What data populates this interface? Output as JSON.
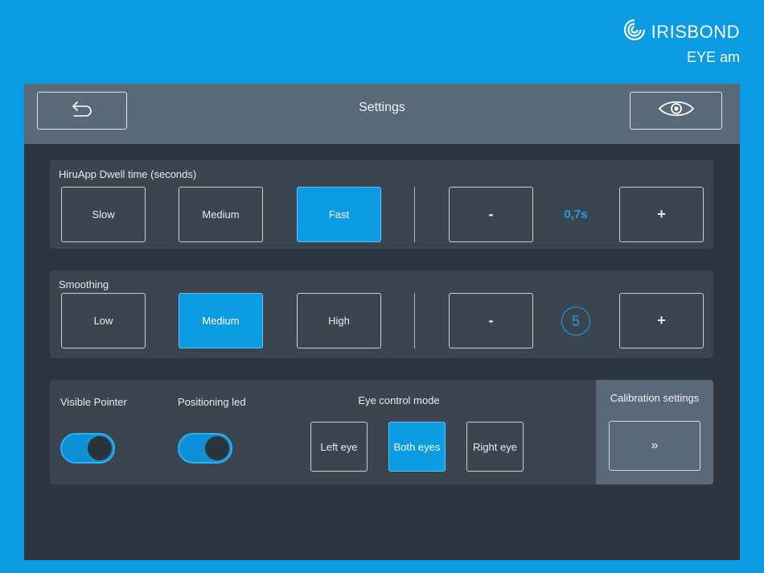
{
  "brand": {
    "name": "IRISBOND",
    "subtitle": "EYE am",
    "logo_icon": "concentric-arc-logo"
  },
  "header": {
    "title": "Settings",
    "back_icon": "back-arrow-icon",
    "eye_icon": "eye-icon"
  },
  "dwell": {
    "label": "HiruApp Dwell time (seconds)",
    "options": [
      "Slow",
      "Medium",
      "Fast"
    ],
    "selected": "Fast",
    "minus": "-",
    "value": "0,7s",
    "plus": "+"
  },
  "smoothing": {
    "label": "Smoothing",
    "options": [
      "Low",
      "Medium",
      "High"
    ],
    "selected": "Medium",
    "minus": "-",
    "value": "5",
    "plus": "+"
  },
  "bottom": {
    "visible_pointer": {
      "label": "Visible Pointer",
      "on": true
    },
    "positioning_led": {
      "label": "Positioning led",
      "on": true
    },
    "eye_mode": {
      "label": "Eye control mode",
      "options": [
        "Left eye",
        "Both eyes",
        "Right eye"
      ],
      "selected": "Both eyes"
    },
    "calibration": {
      "label": "Calibration settings",
      "button": "»"
    }
  },
  "colors": {
    "accent": "#0a9be2",
    "panel": "#2d3640",
    "card": "#3b4550",
    "bar": "#5a6978"
  }
}
